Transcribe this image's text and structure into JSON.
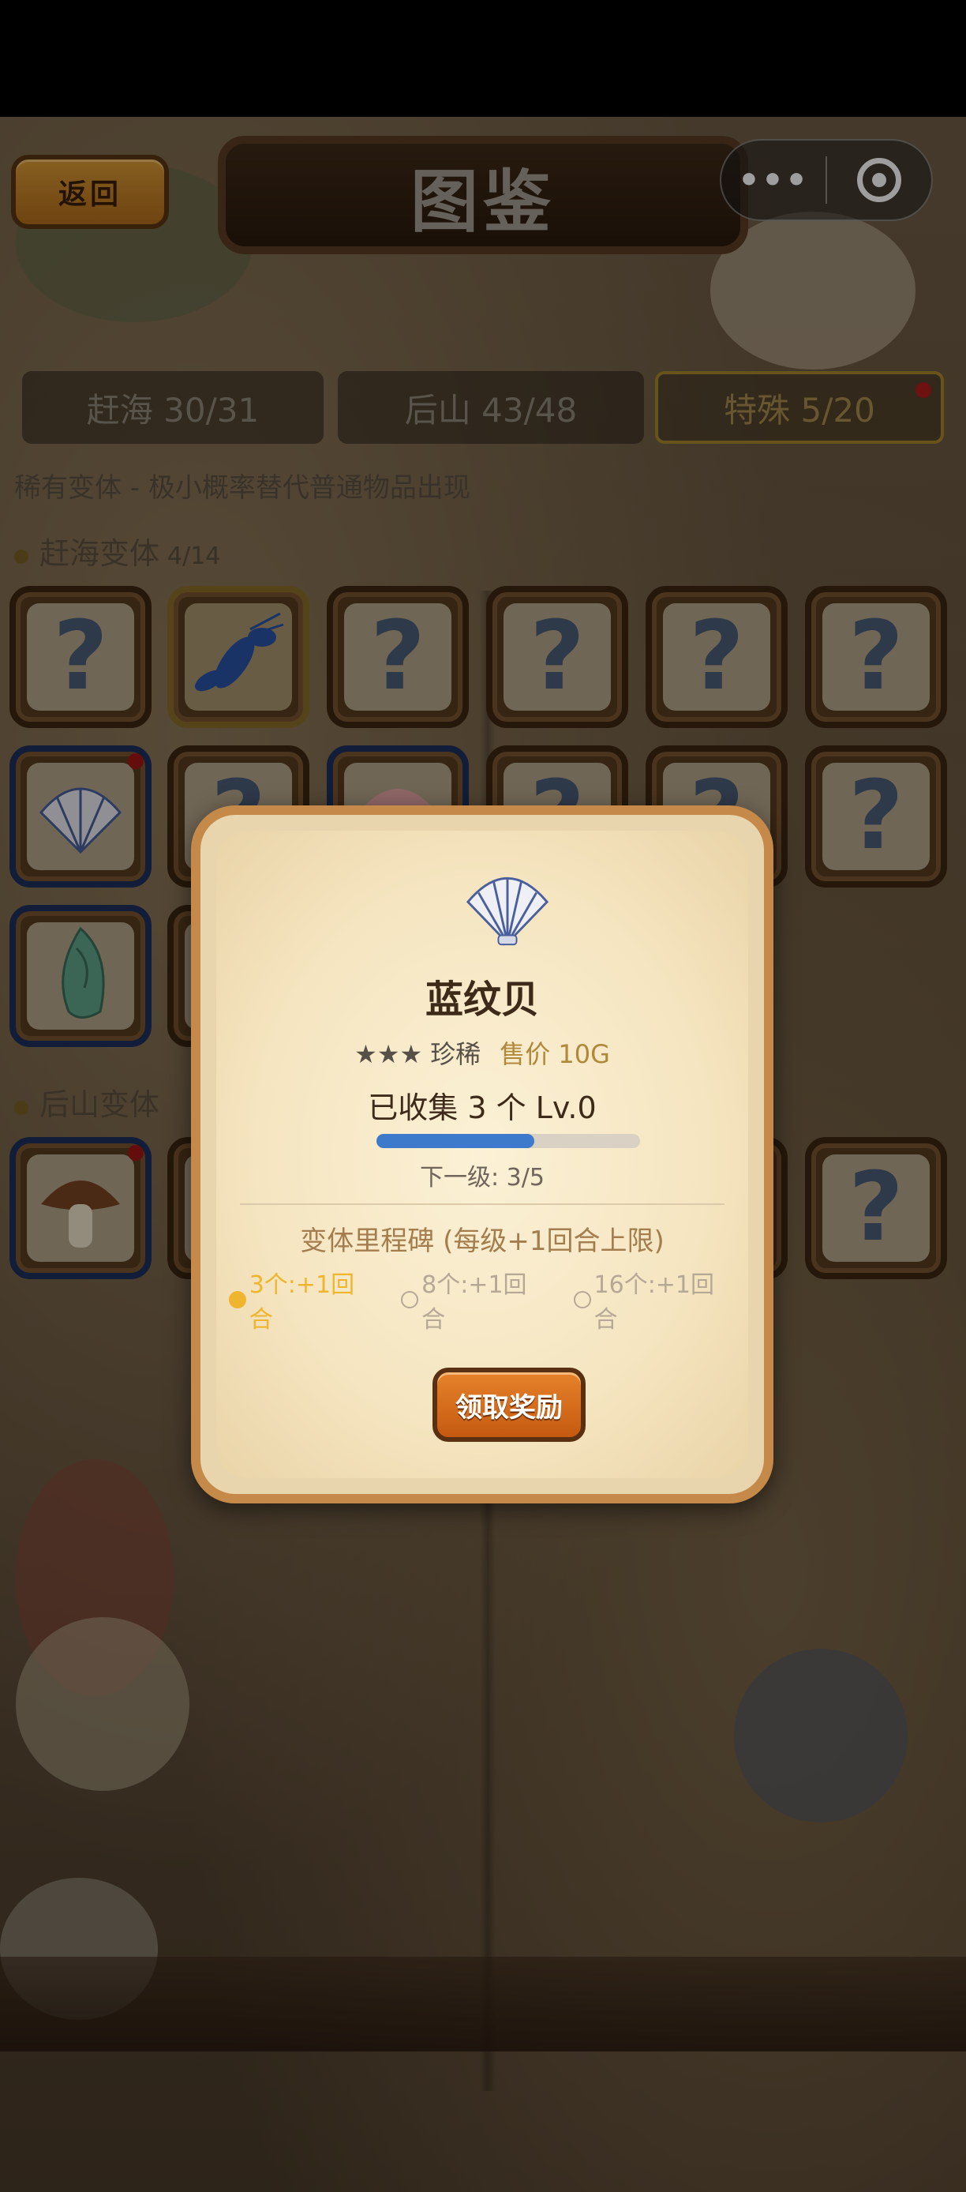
{
  "header": {
    "back_label": "返回",
    "title": "图鉴",
    "capsule": {
      "menu_icon": "more-dots-icon",
      "close_icon": "target-circle-icon"
    }
  },
  "tabs": [
    {
      "label": "赶海 30/31",
      "active": false
    },
    {
      "label": "后山 43/48",
      "active": false
    },
    {
      "label": "特殊 5/20",
      "active": true,
      "has_badge": true
    }
  ],
  "note": "稀有变体 - 极小概率替代普通物品出现",
  "sections": [
    {
      "name": "赶海变体",
      "count": "4/14"
    },
    {
      "name": "后山变体",
      "count": ""
    }
  ],
  "grid_items": [
    {
      "state": "unknown",
      "symbol": "?"
    },
    {
      "state": "collected",
      "icon": "blue-lobster-icon"
    },
    {
      "state": "unknown",
      "symbol": "?"
    },
    {
      "state": "unknown",
      "symbol": "?"
    },
    {
      "state": "unknown",
      "symbol": "?"
    },
    {
      "state": "unknown",
      "symbol": "?"
    },
    {
      "state": "collected",
      "icon": "blue-pattern-shell-icon",
      "has_badge": true
    },
    {
      "state": "unknown",
      "symbol": "?"
    },
    {
      "state": "collected",
      "icon": "pink-shell-icon"
    },
    {
      "state": "unknown",
      "symbol": "?"
    },
    {
      "state": "unknown",
      "symbol": "?"
    },
    {
      "state": "unknown",
      "symbol": "?"
    },
    {
      "state": "collected",
      "icon": "green-conch-icon"
    },
    {
      "state": "collected",
      "icon": "shiitake-mushroom-icon",
      "has_badge": true
    },
    {
      "state": "unknown",
      "symbol": "?"
    }
  ],
  "modal": {
    "icon": "blue-pattern-shell-icon",
    "name": "蓝纹贝",
    "stars": "★★★",
    "rarity": "珍稀",
    "price": "售价 10G",
    "collected": "已收集 3 个 Lv.0",
    "progress": 0.6,
    "next_level": "下一级: 3/5",
    "milestone_title": "变体里程碑 (每级+1回合上限)",
    "milestones": [
      {
        "label": "3个:+1回合",
        "done": true
      },
      {
        "label": "8个:+1回合",
        "done": false
      },
      {
        "label": "16个:+1回合",
        "done": false
      }
    ],
    "button_label": "领取奖励"
  },
  "colors": {
    "progress_fill": "#3e7acb",
    "milestone_done": "#f0b52e",
    "button": "#d9731f",
    "badge": "#b01c1c"
  }
}
